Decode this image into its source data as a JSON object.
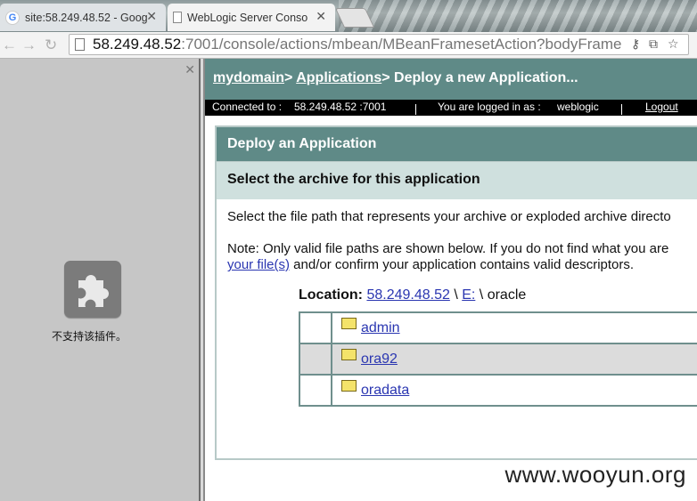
{
  "browser": {
    "tabs": [
      {
        "title": "site:58.249.48.52 - Goog",
        "active": false,
        "icon": "google-icon"
      },
      {
        "title": "WebLogic Server Conso",
        "active": true,
        "icon": "document-icon"
      }
    ],
    "url_host": "58.249.48.52",
    "url_rest": ":7001/console/actions/mbean/MBeanFramesetAction?bodyFrame"
  },
  "plugin": {
    "message": "不支持该插件。"
  },
  "console": {
    "breadcrumb": {
      "domain": "mydomain",
      "sep1": "> ",
      "applications": "Applications",
      "sep2": "> ",
      "current": "Deploy a new Application..."
    },
    "status": {
      "connected_label": "Connected to :",
      "connected_value": "58.249.48.52 :7001",
      "logged_label": "You are logged in as :",
      "logged_value": "weblogic",
      "logout": "Logout"
    },
    "panel": {
      "title": "Deploy an Application",
      "subtitle": "Select the archive for this application",
      "intro": "Select the file path that represents your archive or exploded archive directo",
      "note_line1": "Note: Only valid file paths are shown below. If you do not find what you are",
      "note_link": "your file(s)",
      "note_line2_rest": " and/or confirm your application contains valid descriptors.",
      "location_label": "Location:",
      "location_host": "58.249.48.52",
      "location_sep1": " \\ ",
      "location_drive": "E:",
      "location_sep2": " \\ ",
      "location_dir": "oracle"
    },
    "files": [
      {
        "name": "admin"
      },
      {
        "name": "ora92"
      },
      {
        "name": "oradata"
      }
    ]
  },
  "watermark": "www.wooyun.org"
}
